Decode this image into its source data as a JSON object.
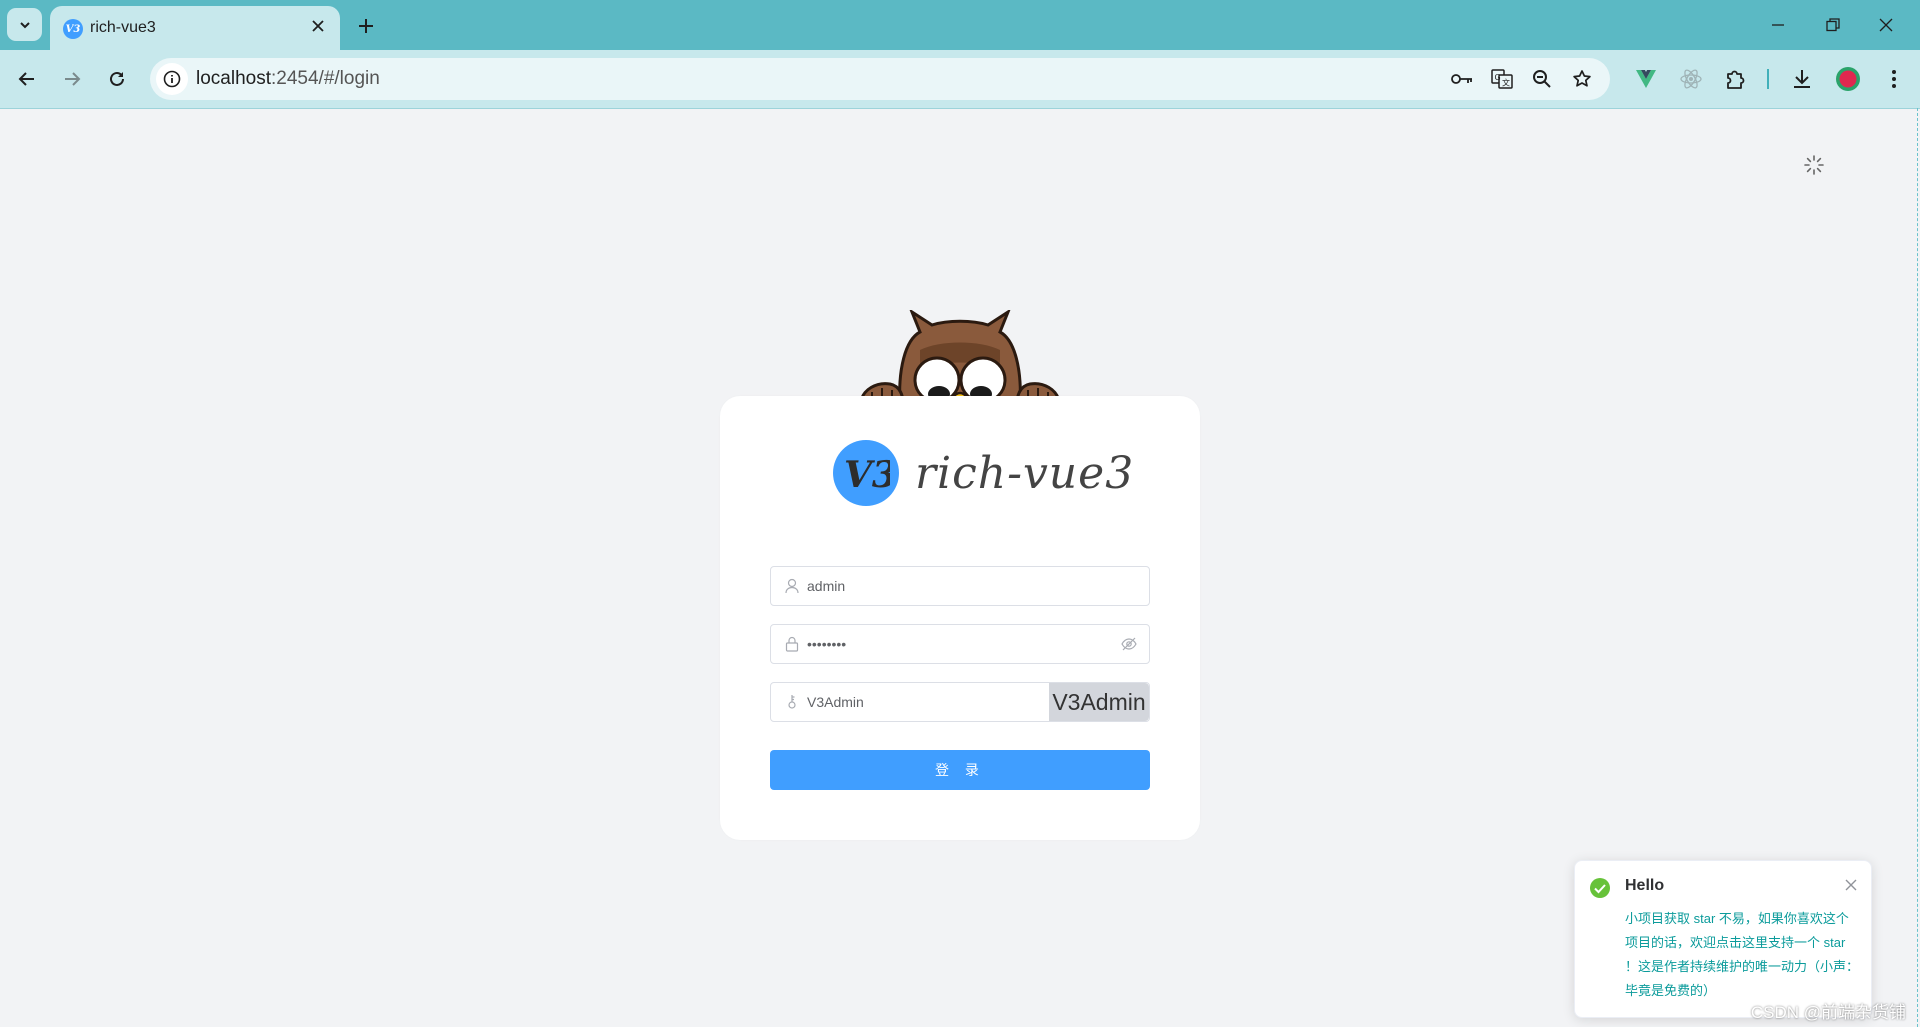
{
  "browser": {
    "tab_title": "rich-vue3",
    "url_host": "localhost",
    "url_rest": ":2454/#/login",
    "colors": {
      "frame": "#5bb9c4",
      "toolbar": "#c7e8ec"
    }
  },
  "login": {
    "brand_logo_text": "V3",
    "brand_name": "rich-vue3",
    "username": "admin",
    "password_mask": "••••••••",
    "captcha_value": "V3Admin",
    "captcha_image_text": "V3Admin",
    "submit_label": "登 录",
    "accent": "#409eff"
  },
  "notification": {
    "title": "Hello",
    "message": "小项目获取 star 不易，如果你喜欢这个项目的话，欢迎点击这里支持一个 star ！这是作者持续维护的唯一动力（小声：毕竟是免费的）"
  },
  "watermark": "CSDN @前端杂货铺"
}
